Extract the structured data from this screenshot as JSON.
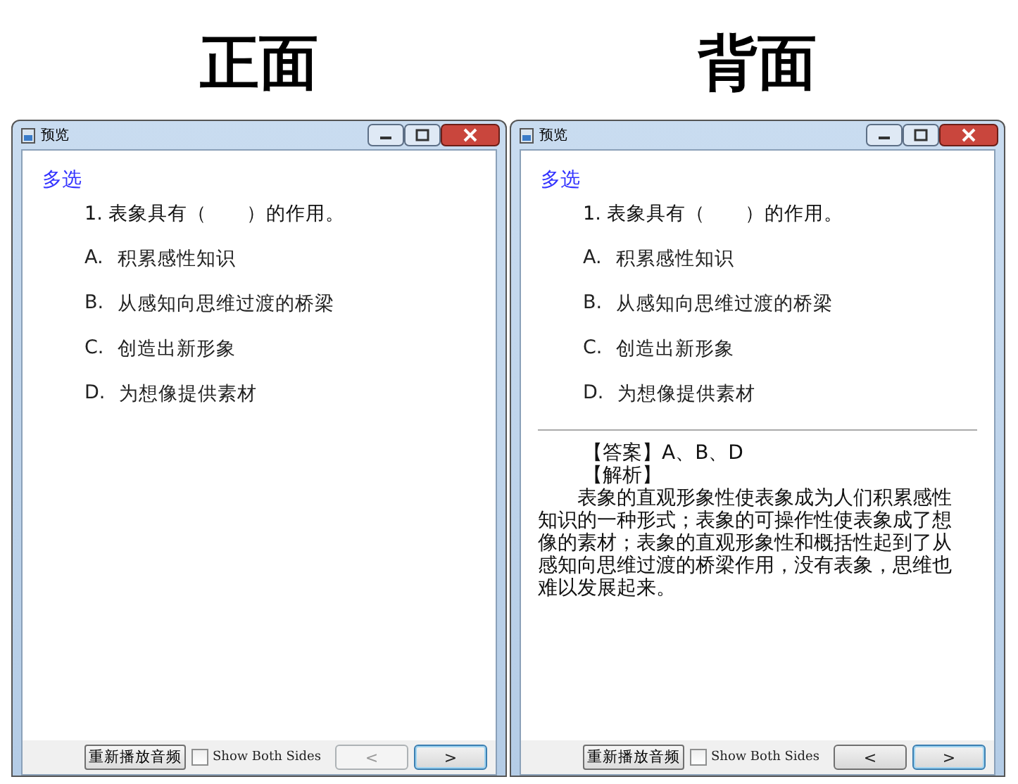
{
  "panels": [
    {
      "heading": "正面",
      "window": {
        "title": "预览"
      },
      "type_label": "多选",
      "question": "1. 表象具有（　　）的作用。",
      "options": [
        {
          "letter": "A.",
          "text": "积累感性知识"
        },
        {
          "letter": "B.",
          "text": "从感知向思维过渡的桥梁"
        },
        {
          "letter": "C.",
          "text": "创造出新形象"
        },
        {
          "letter": "D.",
          "text": "为想像提供素材"
        }
      ],
      "footer": {
        "replay_button": "重新播放音频",
        "show_both_sides": {
          "label": "Show Both Sides",
          "checked": false
        },
        "prev": {
          "label": "<",
          "disabled": true
        },
        "next": {
          "label": ">",
          "focused": true
        }
      }
    },
    {
      "heading": "背面",
      "window": {
        "title": "预览"
      },
      "type_label": "多选",
      "question": "1. 表象具有（　　）的作用。",
      "options": [
        {
          "letter": "A.",
          "text": "积累感性知识"
        },
        {
          "letter": "B.",
          "text": "从感知向思维过渡的桥梁"
        },
        {
          "letter": "C.",
          "text": "创造出新形象"
        },
        {
          "letter": "D.",
          "text": "为想像提供素材"
        }
      ],
      "answer": {
        "answer_line": "【答案】A、B、D",
        "analysis_label": "【解析】",
        "analysis": "表象的直观形象性使表象成为人们积累感性知识的一种形式；表象的可操作性使表象成了想像的素材；表象的直观形象性和概括性起到了从感知向思维过渡的桥梁作用，没有表象，思维也难以发展起来。"
      },
      "footer": {
        "replay_button": "重新播放音频",
        "show_both_sides": {
          "label": "Show Both Sides",
          "checked": false
        },
        "prev": {
          "label": "<",
          "disabled": false
        },
        "next": {
          "label": ">",
          "focused": true
        }
      }
    }
  ]
}
